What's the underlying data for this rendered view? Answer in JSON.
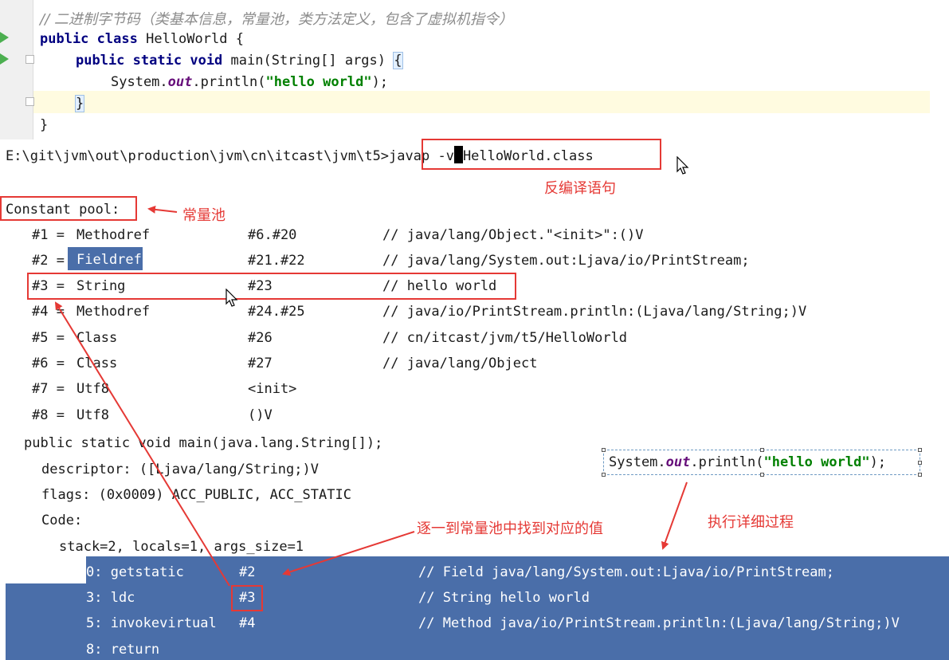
{
  "editor": {
    "comment": "// 二进制字节码（类基本信息，常量池，类方法定义，包含了虚拟机指令）",
    "kw_public": "public",
    "kw_class": "class",
    "class_name": "HelloWorld {",
    "kw_static": "static",
    "kw_void": "void",
    "main_sig": "main(String[] args) ",
    "open_brace": "{",
    "sys_prefix": "System.",
    "sys_out": "out",
    "sys_println": ".println(",
    "sys_string": "\"hello world\"",
    "sys_end": ");",
    "close_brace_inner": "}",
    "close_brace_outer": "}"
  },
  "terminal": {
    "path": "E:\\git\\jvm\\out\\production\\jvm\\cn\\itcast\\jvm\\t5>",
    "cmd_before_cursor": "javap -v",
    "cmd_after_cursor": "HelloWorld.class",
    "constant_pool_header": "Constant pool:",
    "pool": [
      {
        "idx": "#1 = ",
        "type": "Methodref",
        "ref": "#6.#20",
        "comment": "// java/lang/Object.\"<init>\":()V"
      },
      {
        "idx": "#2 = ",
        "type": "Fieldref",
        "ref": "#21.#22",
        "comment": "// java/lang/System.out:Ljava/io/PrintStream;"
      },
      {
        "idx": "#3 = ",
        "type": "String",
        "ref": "#23",
        "comment": "// hello world"
      },
      {
        "idx": "#4 = ",
        "type": "Methodref",
        "ref": "#24.#25",
        "comment": "// java/io/PrintStream.println:(Ljava/lang/String;)V"
      },
      {
        "idx": "#5 = ",
        "type": "Class",
        "ref": "#26",
        "comment": "// cn/itcast/jvm/t5/HelloWorld"
      },
      {
        "idx": "#6 = ",
        "type": "Class",
        "ref": "#27",
        "comment": "// java/lang/Object"
      },
      {
        "idx": "#7 = ",
        "type": "Utf8",
        "ref": "<init>",
        "comment": ""
      },
      {
        "idx": "#8 = ",
        "type": "Utf8",
        "ref": "()V",
        "comment": ""
      }
    ],
    "method_sig": "public static void main(java.lang.String[]);",
    "descriptor": "descriptor: ([Ljava/lang/String;)V",
    "flags": "flags: (0x0009) ACC_PUBLIC, ACC_STATIC",
    "code_label": "Code:",
    "stack": "stack=2, locals=1, args_size=1",
    "instructions": [
      {
        "op": "0: getstatic",
        "arg": "#2",
        "comment": "// Field java/lang/System.out:Ljava/io/PrintStream;"
      },
      {
        "op": "3: ldc",
        "arg": "#3",
        "comment": "// String hello world"
      },
      {
        "op": "5: invokevirtual",
        "arg": "#4",
        "comment": "// Method java/io/PrintStream.println:(Ljava/lang/String;)V"
      },
      {
        "op": "8: return",
        "arg": "",
        "comment": ""
      }
    ]
  },
  "annotations": {
    "decompile": "反编译语句",
    "constant_pool": "常量池",
    "lookup": "逐一到常量池中找到对应的值",
    "exec_detail": "执行详细过程",
    "snippet_prefix": "System.",
    "snippet_out": "out",
    "snippet_println": ".println(",
    "snippet_string": "\"hello world\"",
    "snippet_end": ");"
  },
  "colors": {
    "highlight_blue": "#4a6ea9",
    "annotation_red": "#e53935",
    "keyword_navy": "#000080",
    "string_green": "#008000"
  }
}
